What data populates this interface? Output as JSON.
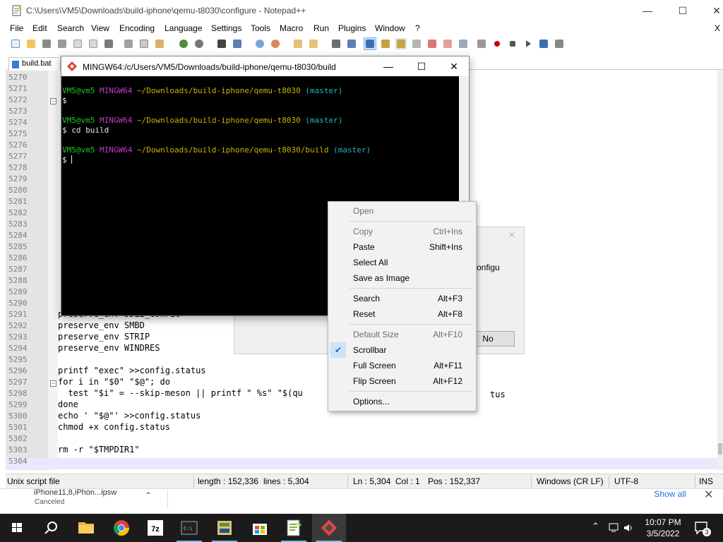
{
  "npp": {
    "title": "C:\\Users\\VM5\\Downloads\\build-iphone\\qemu-t8030\\configure - Notepad++",
    "menu": [
      "File",
      "Edit",
      "Search",
      "View",
      "Encoding",
      "Language",
      "Settings",
      "Tools",
      "Macro",
      "Run",
      "Plugins",
      "Window",
      "?"
    ],
    "menu_close": "X",
    "tab_label": "build.bat",
    "lines": [
      {
        "num": "5270",
        "code": ""
      },
      {
        "num": "5271",
        "code": ""
      },
      {
        "num": "5272",
        "code": ""
      },
      {
        "num": "5273",
        "code": ""
      },
      {
        "num": "5274",
        "code": ""
      },
      {
        "num": "5275",
        "code": ""
      },
      {
        "num": "5276",
        "code": ""
      },
      {
        "num": "5277",
        "code": ""
      },
      {
        "num": "5278",
        "code": ""
      },
      {
        "num": "5279",
        "code": ""
      },
      {
        "num": "5280",
        "code": ""
      },
      {
        "num": "5281",
        "code": ""
      },
      {
        "num": "5282",
        "code": ""
      },
      {
        "num": "5283",
        "code": ""
      },
      {
        "num": "5284",
        "code": ""
      },
      {
        "num": "5285",
        "code": ""
      },
      {
        "num": "5286",
        "code": ""
      },
      {
        "num": "5287",
        "code": ""
      },
      {
        "num": "5288",
        "code": ""
      },
      {
        "num": "5289",
        "code": ""
      },
      {
        "num": "5290",
        "code": ""
      },
      {
        "num": "5291",
        "code": "preserve_env SDL2_CONFIG"
      },
      {
        "num": "5292",
        "code": "preserve_env SMBD"
      },
      {
        "num": "5293",
        "code": "preserve_env STRIP"
      },
      {
        "num": "5294",
        "code": "preserve_env WINDRES"
      },
      {
        "num": "5295",
        "code": ""
      },
      {
        "num": "5296",
        "code": "printf \"exec\" >>config.status"
      },
      {
        "num": "5297",
        "code": "for i in \"$0\" \"$@\"; do"
      },
      {
        "num": "5298",
        "code": "  test \"$i\" = --skip-meson || printf \" %s\" \"$(qu"
      },
      {
        "num": "5299",
        "code": "done"
      },
      {
        "num": "5300",
        "code": "echo ' \"$@\"' >>config.status"
      },
      {
        "num": "5301",
        "code": "chmod +x config.status"
      },
      {
        "num": "5302",
        "code": ""
      },
      {
        "num": "5303",
        "code": "rm -r \"$TMPDIR1\""
      },
      {
        "num": "5304",
        "code": ""
      }
    ],
    "code_tail_5298": "tus",
    "status": {
      "type": "Unix script file",
      "length": "length : 152,336",
      "lines": "lines : 5,304",
      "ln": "Ln : 5,304",
      "col": "Col : 1",
      "pos": "Pos : 152,337",
      "eol": "Windows (CR LF)",
      "enc": "UTF-8",
      "mode": "INS"
    }
  },
  "dialog": {
    "text": "onfigu",
    "no_label": "No"
  },
  "terminal": {
    "title": "MINGW64:/c/Users/VM5/Downloads/build-iphone/qemu-t8030/build",
    "prompts": [
      {
        "user": "VM5@vm5",
        "sys": "MINGW64",
        "path": "~/Downloads/build-iphone/qemu-t8030",
        "branch": "(master)",
        "cmd": "$"
      },
      {
        "user": "VM5@vm5",
        "sys": "MINGW64",
        "path": "~/Downloads/build-iphone/qemu-t8030",
        "branch": "(master)",
        "cmd": "$ cd build"
      },
      {
        "user": "VM5@vm5",
        "sys": "MINGW64",
        "path": "~/Downloads/build-iphone/qemu-t8030/build",
        "branch": "(master)",
        "cmd": "$ "
      }
    ]
  },
  "context_menu": {
    "items": [
      {
        "label": "Open",
        "accel": "",
        "disabled": true
      },
      {
        "label": "Copy",
        "accel": "Ctrl+Ins",
        "disabled": true
      },
      {
        "label": "Paste",
        "accel": "Shift+Ins",
        "disabled": false
      },
      {
        "label": "Select All",
        "accel": "",
        "disabled": false
      },
      {
        "label": "Save as Image",
        "accel": "",
        "disabled": false
      },
      {
        "label": "Search",
        "accel": "Alt+F3",
        "disabled": false
      },
      {
        "label": "Reset",
        "accel": "Alt+F8",
        "disabled": false
      },
      {
        "label": "Default Size",
        "accel": "Alt+F10",
        "disabled": true
      },
      {
        "label": "Scrollbar",
        "accel": "",
        "disabled": false,
        "checked": true
      },
      {
        "label": "Full Screen",
        "accel": "Alt+F11",
        "disabled": false
      },
      {
        "label": "Flip Screen",
        "accel": "Alt+F12",
        "disabled": false
      },
      {
        "label": "Options...",
        "accel": "",
        "disabled": false
      }
    ]
  },
  "download_bar": {
    "filename": "iPhone11,8,iPhon...ipsw",
    "status": "Canceled",
    "show_all": "Show all"
  },
  "taskbar": {
    "time": "10:07 PM",
    "date": "3/5/2022",
    "notification_count": "3",
    "icons": [
      "windows-start-icon",
      "search-icon",
      "file-explorer-icon",
      "chrome-icon",
      "7zip-icon",
      "terminal-icon",
      "git-gui-icon",
      "store-icon",
      "notepadpp-icon",
      "git-bash-icon"
    ]
  },
  "colors": {
    "terminal_user": "#1fc91f",
    "terminal_system": "#c43cc4",
    "terminal_path": "#c8b400",
    "terminal_branch": "#27b3c4",
    "accent": "#76b9ed"
  }
}
